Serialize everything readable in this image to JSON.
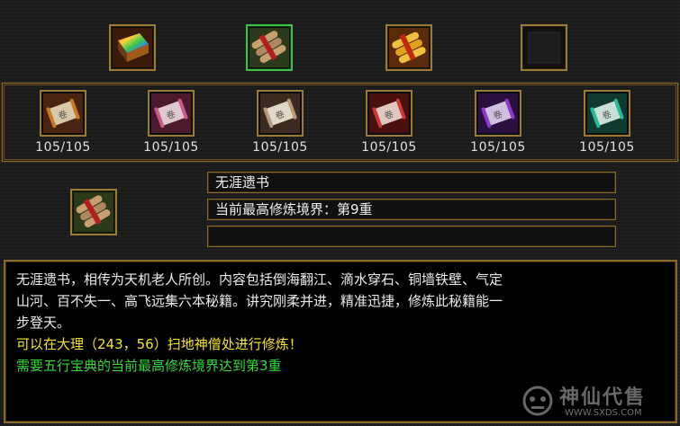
{
  "top_slots": [
    {
      "icon": "rainbow-book-icon",
      "selected": false
    },
    {
      "icon": "scroll-bundle-icon",
      "selected": true
    },
    {
      "icon": "golden-scroll-bundle-icon",
      "selected": false
    },
    {
      "icon": "empty-slot-icon",
      "selected": false
    }
  ],
  "skills": [
    {
      "icon": "scroll-orange-icon",
      "count": "105/105",
      "color": "#c8782a"
    },
    {
      "icon": "scroll-pink-icon",
      "count": "105/105",
      "color": "#c85a8a"
    },
    {
      "icon": "scroll-tan-icon",
      "count": "105/105",
      "color": "#b89a7a"
    },
    {
      "icon": "scroll-red-icon",
      "count": "105/105",
      "color": "#c83a3a"
    },
    {
      "icon": "scroll-purple-icon",
      "count": "105/105",
      "color": "#8a3ac8"
    },
    {
      "icon": "scroll-teal-icon",
      "count": "105/105",
      "color": "#2ab89a"
    }
  ],
  "selected_item": {
    "icon": "scroll-bundle-icon",
    "name": "无涯遗书",
    "realm": "当前最高修炼境界：第9重",
    "extra": ""
  },
  "description": {
    "line1": "无涯遗书，相传为天机老人所创。内容包括倒海翻江、滴水穿石、铜墙铁壁、气定",
    "line2": "山河、百不失一、高飞远集六本秘籍。讲究刚柔并进，精准迅捷，修炼此秘籍能一",
    "line3": "步登天。",
    "location": "可以在大理（243，56）扫地神僧处进行修炼！",
    "requirement": "需要五行宝典的当前最高修炼境界达到第3重"
  },
  "watermark": {
    "title": "神仙代售",
    "url": "WWW.SXDS.COM"
  }
}
